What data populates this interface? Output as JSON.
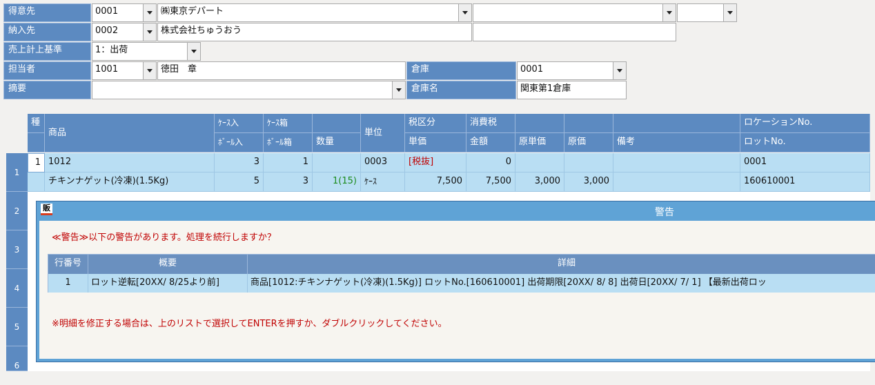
{
  "header": {
    "customer": {
      "label": "得意先",
      "code": "0001",
      "name": "㈱東京デパート",
      "extra1": "",
      "extra2": ""
    },
    "delivery": {
      "label": "納入先",
      "code": "0002",
      "name": "株式会社ちゅうおう",
      "extra": ""
    },
    "sales_basis": {
      "label": "売上計上基準",
      "value": "1：出荷"
    },
    "staff": {
      "label": "担当者",
      "code": "1001",
      "name": "徳田　章"
    },
    "warehouse": {
      "label": "倉庫",
      "code": "0001"
    },
    "memo": {
      "label": "摘要",
      "value": ""
    },
    "warehouse_name": {
      "label": "倉庫名",
      "value": "関東第1倉庫"
    }
  },
  "grid": {
    "headers_top": [
      "種",
      "商品",
      "ｹｰｽ入",
      "ｹｰｽ箱",
      "",
      "単位",
      "税区分",
      "消費税",
      "",
      "",
      "",
      "ロケーションNo."
    ],
    "headers_bottom": [
      "",
      "",
      "ﾎﾞｰﾙ入",
      "ﾎﾞｰﾙ箱",
      "数量",
      "",
      "単価",
      "金額",
      "原単価",
      "原価",
      "備考",
      "ロットNo."
    ],
    "row1_top": [
      "1",
      "1012",
      "3",
      "1",
      "",
      "0003",
      "[税抜]",
      "0",
      "",
      "",
      "",
      "0001"
    ],
    "row1_bottom": [
      "",
      "チキンナゲット(冷凍)(1.5Kg)",
      "5",
      "3",
      "1(15)",
      "ｹｰｽ",
      "7,500",
      "7,500",
      "3,000",
      "3,000",
      "",
      "160610001"
    ],
    "row_numbers": [
      "1",
      "2",
      "3",
      "4",
      "5",
      "6"
    ]
  },
  "dialog": {
    "icon_text": "販",
    "title": "警告",
    "message": "≪警告≫以下の警告があります。処理を続行しますか？",
    "columns": [
      "行番号",
      "概要",
      "詳細"
    ],
    "rows": [
      {
        "no": "1",
        "summary": "ロット逆転[20XX/ 8/25より前]",
        "detail": "商品[1012:チキンナゲット(冷凍)(1.5Kg)] ロットNo.[160610001] 出荷期限[20XX/ 8/ 8] 出荷日[20XX/ 7/ 1] 【最新出荷ロッ"
      }
    ],
    "footer": "※明細を修正する場合は、上のリストで選択してENTERを押すか、ダブルクリックしてください。"
  }
}
